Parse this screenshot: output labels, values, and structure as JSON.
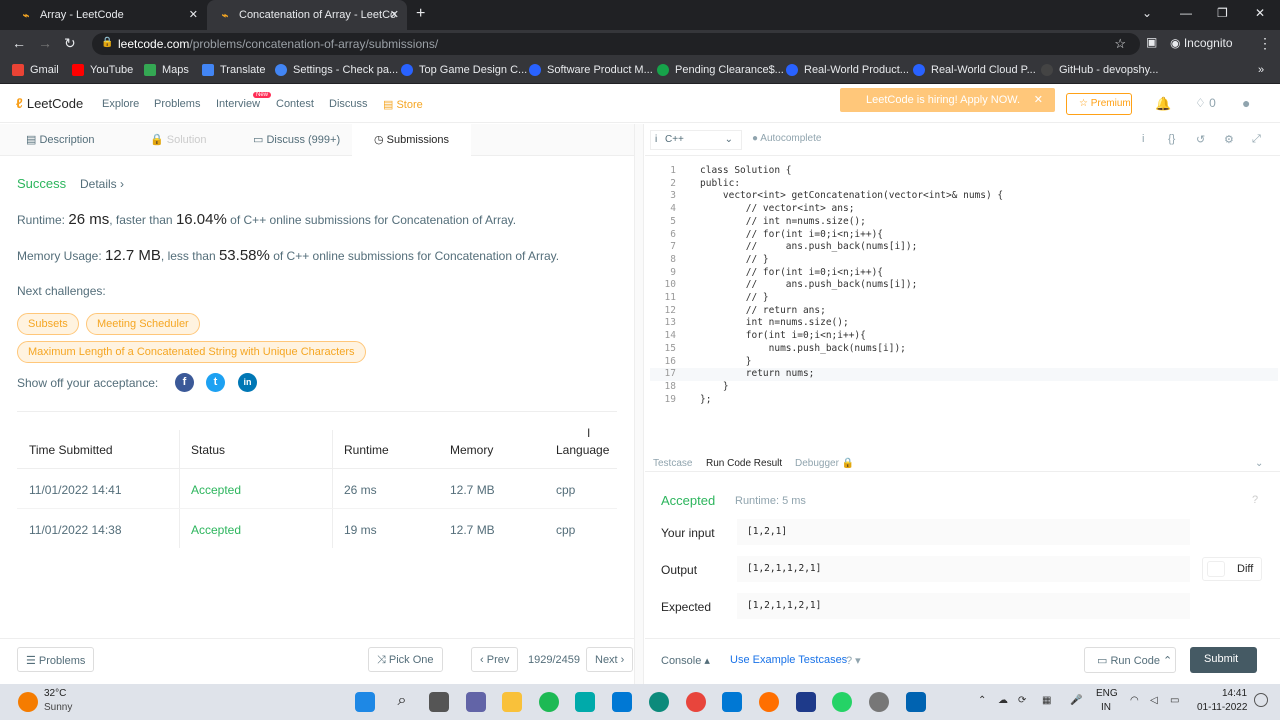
{
  "browser": {
    "tabs": [
      {
        "title": "Array - LeetCode"
      },
      {
        "title": "Concatenation of Array - LeetCo"
      }
    ],
    "url_host": "leetcode.com",
    "url_path": "/problems/concatenation-of-array/submissions/",
    "profile_label": "Incognito",
    "bookmarks": [
      {
        "label": "Gmail",
        "color": "#ea4335"
      },
      {
        "label": "YouTube",
        "color": "#ff0000"
      },
      {
        "label": "Maps",
        "color": "#34a853"
      },
      {
        "label": "Translate",
        "color": "#4285f4"
      },
      {
        "label": "Settings - Check pa...",
        "color": "#4285f4"
      },
      {
        "label": "Top Game Design C...",
        "color": "#2962ff"
      },
      {
        "label": "Software Product M...",
        "color": "#2962ff"
      },
      {
        "label": "Pending Clearance$...",
        "color": "#16a34a"
      },
      {
        "label": "Real-World Product...",
        "color": "#2962ff"
      },
      {
        "label": "Real-World Cloud P...",
        "color": "#2962ff"
      },
      {
        "label": "GitHub - devopshy...",
        "color": "#444"
      }
    ]
  },
  "leetcode_nav": {
    "logo_text": "LeetCode",
    "links": [
      "Explore",
      "Problems",
      "Interview",
      "Contest",
      "Discuss",
      "Store"
    ],
    "new_badge": "New",
    "hiring_banner": "LeetCode is hiring! Apply NOW.",
    "premium_label": "Premium",
    "points": "0"
  },
  "left_tabs": [
    "Description",
    "Solution",
    "Discuss (999+)",
    "Submissions"
  ],
  "result": {
    "status": "Success",
    "details_label": "Details",
    "runtime_prefix": "Runtime:",
    "runtime_value": "26 ms",
    "runtime_mid": ", faster than",
    "runtime_pct": "16.04%",
    "runtime_suffix": "of C++ online submissions for Concatenation of Array.",
    "memory_prefix": "Memory Usage:",
    "memory_value": "12.7 MB",
    "memory_mid": ", less than",
    "memory_pct": "53.58%",
    "memory_suffix": "of C++ online submissions for Concatenation of Array.",
    "next_label": "Next challenges:",
    "challenges": [
      "Subsets",
      "Meeting Scheduler",
      "Maximum Length of a Concatenated String with Unique Characters"
    ],
    "share_label": "Show off your acceptance:",
    "social_icons": [
      "f",
      "t",
      "in"
    ]
  },
  "submissions_table": {
    "headers": [
      "Time Submitted",
      "Status",
      "Runtime",
      "Memory",
      "Language"
    ],
    "rows": [
      [
        "11/01/2022 14:41",
        "Accepted",
        "26 ms",
        "12.7 MB",
        "cpp"
      ],
      [
        "11/01/2022 14:38",
        "Accepted",
        "19 ms",
        "12.7 MB",
        "cpp"
      ]
    ]
  },
  "bottom_left": {
    "problems_btn": "Problems",
    "pick_one_btn": "Pick One",
    "prev_btn": "Prev",
    "page_counter": "1929/2459",
    "next_btn": "Next"
  },
  "editor": {
    "language": "C++",
    "autocomplete": "Autocomplete",
    "lines": [
      "class Solution {",
      "public:",
      "    vector<int> getConcatenation(vector<int>& nums) {",
      "        // vector<int> ans;",
      "        // int n=nums.size();",
      "        // for(int i=0;i<n;i++){",
      "        //     ans.push_back(nums[i]);",
      "        // }",
      "        // for(int i=0;i<n;i++){",
      "        //     ans.push_back(nums[i]);",
      "        // }",
      "        // return ans;",
      "        int n=nums.size();",
      "        for(int i=0;i<n;i++){",
      "            nums.push_back(nums[i]);",
      "        }",
      "        return nums;",
      "    }",
      "};"
    ],
    "highlighted_line": 17
  },
  "console": {
    "tabs": [
      "Testcase",
      "Run Code Result",
      "Debugger"
    ],
    "status": "Accepted",
    "runtime": "Runtime: 5 ms",
    "your_input_label": "Your input",
    "your_input": "[1,2,1]",
    "output_label": "Output",
    "output": "[1,2,1,1,2,1]",
    "expected_label": "Expected",
    "expected": "[1,2,1,1,2,1]",
    "diff_label": "Diff",
    "console_btn": "Console",
    "example_testcases": "Use Example Testcases",
    "run_code_btn": "Run Code",
    "submit_btn": "Submit"
  },
  "taskbar": {
    "weather_temp": "32°C",
    "weather_desc": "Sunny",
    "lang": "ENG",
    "region": "IN",
    "time": "14:41",
    "date": "01-11-2022"
  }
}
